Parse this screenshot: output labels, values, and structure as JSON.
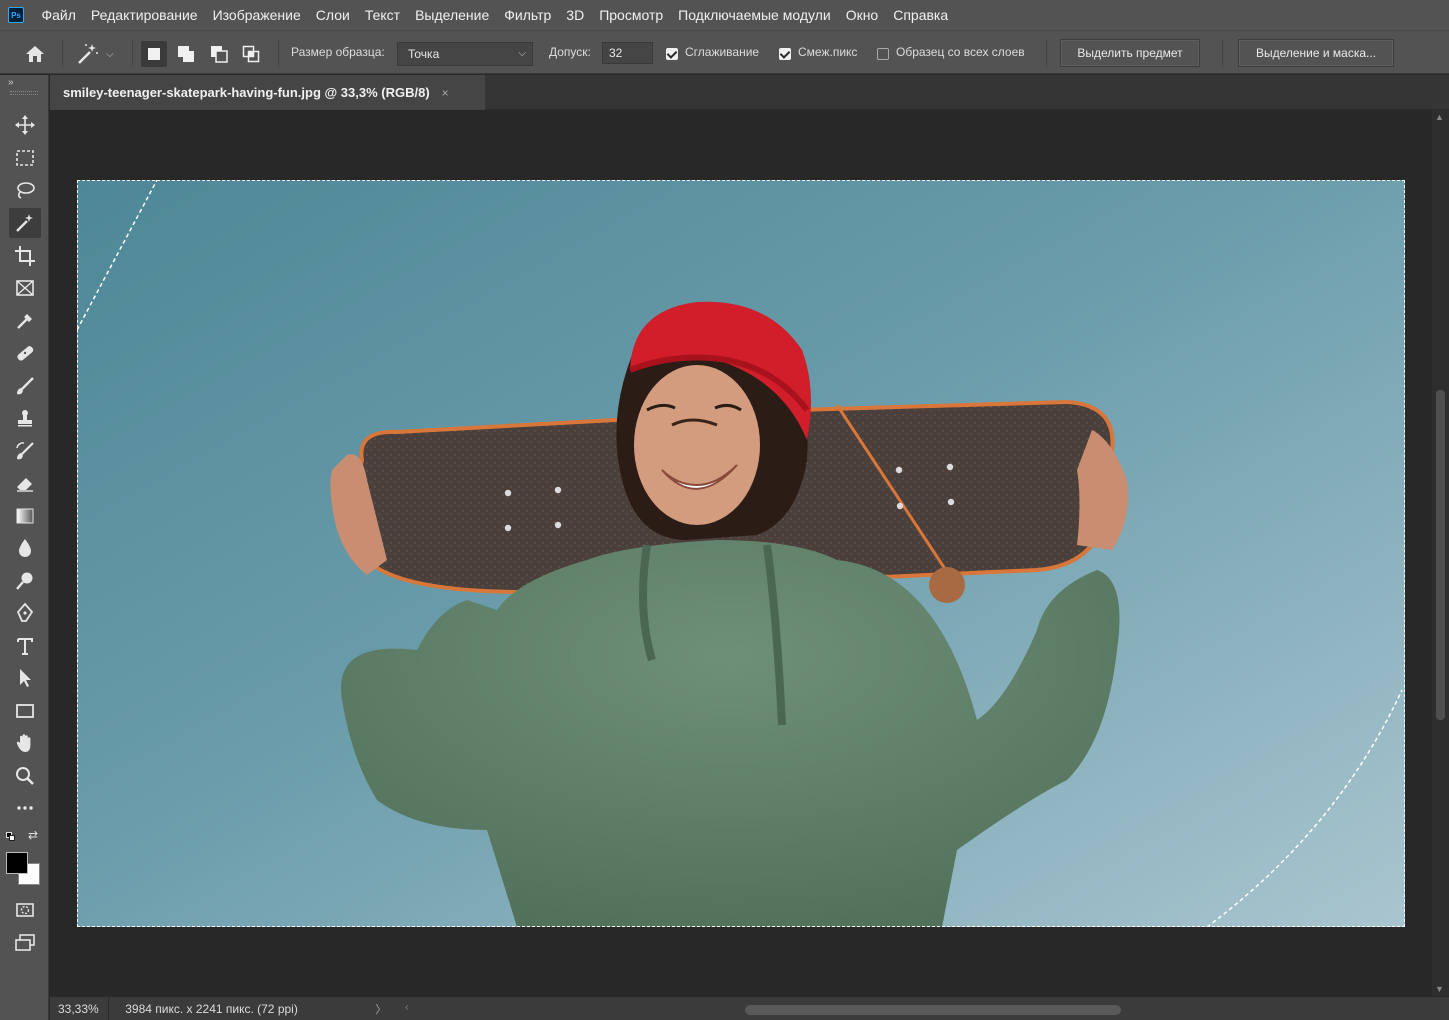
{
  "app": {
    "logo_text": "Ps"
  },
  "menu": [
    "Файл",
    "Редактирование",
    "Изображение",
    "Слои",
    "Текст",
    "Выделение",
    "Фильтр",
    "3D",
    "Просмотр",
    "Подключаемые модули",
    "Окно",
    "Справка"
  ],
  "options": {
    "sample_size_label": "Размер образца:",
    "sample_size_value": "Точка",
    "tolerance_label": "Допуск:",
    "tolerance_value": "32",
    "antialias_label": "Сглаживание",
    "antialias_checked": true,
    "contiguous_label": "Смеж.пикс",
    "contiguous_checked": true,
    "sample_all_layers_label": "Образец со всех слоев",
    "sample_all_layers_checked": false,
    "select_subject_label": "Выделить предмет",
    "select_and_mask_label": "Выделение и маска..."
  },
  "document": {
    "tab_title": "smiley-teenager-skatepark-having-fun.jpg @ 33,3% (RGB/8)",
    "close_glyph": "×"
  },
  "tools": [
    {
      "name": "move-tool",
      "icon": "move-icon"
    },
    {
      "name": "marquee-tool",
      "icon": "rect-marquee-icon"
    },
    {
      "name": "lasso-tool",
      "icon": "lasso-icon"
    },
    {
      "name": "magic-wand-tool",
      "icon": "magic-wand-icon",
      "active": true
    },
    {
      "name": "crop-tool",
      "icon": "crop-icon"
    },
    {
      "name": "frame-tool",
      "icon": "frame-icon"
    },
    {
      "name": "eyedropper-tool",
      "icon": "eyedropper-icon"
    },
    {
      "name": "healing-brush-tool",
      "icon": "bandage-icon"
    },
    {
      "name": "brush-tool",
      "icon": "brush-icon"
    },
    {
      "name": "clone-stamp-tool",
      "icon": "stamp-icon"
    },
    {
      "name": "history-brush-tool",
      "icon": "history-brush-icon"
    },
    {
      "name": "eraser-tool",
      "icon": "eraser-icon"
    },
    {
      "name": "gradient-tool",
      "icon": "gradient-icon"
    },
    {
      "name": "blur-tool",
      "icon": "drop-icon"
    },
    {
      "name": "dodge-tool",
      "icon": "dodge-icon"
    },
    {
      "name": "pen-tool",
      "icon": "pen-icon"
    },
    {
      "name": "type-tool",
      "icon": "type-icon"
    },
    {
      "name": "path-selection-tool",
      "icon": "arrow-icon"
    },
    {
      "name": "rectangle-tool",
      "icon": "rectangle-icon"
    },
    {
      "name": "hand-tool",
      "icon": "hand-icon"
    },
    {
      "name": "zoom-tool",
      "icon": "zoom-icon"
    },
    {
      "name": "edit-toolbar",
      "icon": "more-icon"
    }
  ],
  "colors": {
    "foreground": "#000000",
    "background": "#ffffff",
    "ui_panel": "#535353",
    "canvas_bg": "#282828"
  },
  "status": {
    "zoom": "33,33%",
    "doc_info": "3984 пикс. x 2241 пикс. (72 ppi)",
    "arrow": "〉"
  }
}
